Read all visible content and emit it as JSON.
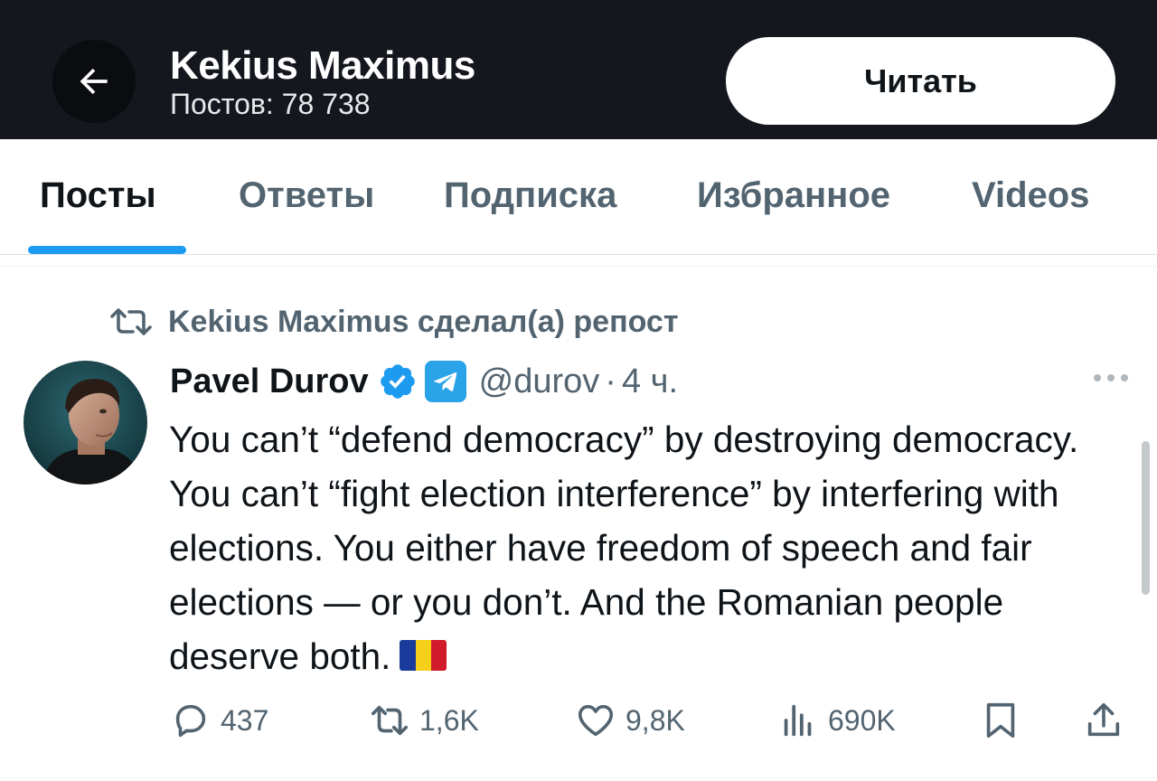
{
  "header": {
    "title": "Kekius Maximus",
    "posts_count": "Постов: 78 738",
    "follow_label": "Читать",
    "background": "#15171f"
  },
  "tabs": [
    {
      "label": "Посты",
      "active": true
    },
    {
      "label": "Ответы",
      "active": false
    },
    {
      "label": "Подписка",
      "active": false
    },
    {
      "label": "Избранное",
      "active": false
    },
    {
      "label": "Videos",
      "active": false
    }
  ],
  "tweet": {
    "repost_label": "Kekius Maximus сделал(а) репост",
    "author_name": "Pavel Durov",
    "handle": "@durov",
    "separator": "·",
    "time": "4 ч.",
    "text": "You can’t “defend democracy” by destroying democracy. You can’t “fight election interference” by interfering with elections. You either have freedom of speech and fair elections — or you don’t. And the Romanian people deserve both.",
    "flag": "romania-flag",
    "stats": {
      "replies": "437",
      "reposts": "1,6K",
      "likes": "9,8K",
      "views": "690K"
    }
  },
  "colors": {
    "accent": "#1d9bf0",
    "secondary_text": "#536471",
    "verified": "#1d9bf0",
    "telegram": "#2aa3e8"
  },
  "icons": [
    "back-arrow-icon",
    "retweet-icon",
    "verified-badge-icon",
    "telegram-icon",
    "more-icon",
    "reply-icon",
    "retweet-icon",
    "heart-icon",
    "views-icon",
    "bookmark-icon",
    "share-icon"
  ]
}
